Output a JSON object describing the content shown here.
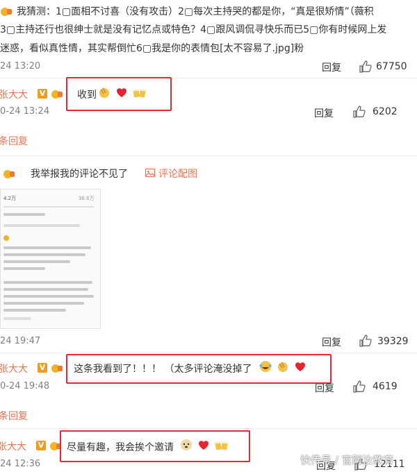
{
  "comments": [
    {
      "text_line1": "我猜测：1▢面相不讨喜（没有攻击）2▢每次主持哭的都是你，“真是很矫情”（薇积",
      "text_line2": "3▢主持还行也很绅士就是没有记忆点或特色？4▢跟风调侃寻快乐而已5▢你有时候网上发",
      "text_line3": "迷惑，看似真性情，其实帮倒忙6▢我是你的表情包[太不容易了.jpg]粉",
      "time": "24 13:20",
      "reply_label": "回复",
      "likes": "67750"
    },
    {
      "author": "张大大",
      "text": "收到",
      "time": "0-24 13:24",
      "reply_label": "回复",
      "likes": "6202",
      "more_replies": "条回复"
    },
    {
      "text": "我举报我的评论不见了",
      "image_link": "评论配图",
      "time": "24 19:47",
      "reply_label": "回复",
      "likes": "39329"
    },
    {
      "author": "张大大",
      "text": "这条我看到了！！！ （太多评论淹没掉了",
      "time": "0-24 19:48",
      "reply_label": "回复",
      "likes": "4619",
      "more_replies": "条回复"
    },
    {
      "author": "张大大",
      "text": "尽量有趣，我会挨个邀请",
      "time": "24 12:36",
      "reply_label": "回复",
      "likes": "12111"
    }
  ],
  "screenshot_thumb": {
    "count": "4.2万",
    "right_count": "36.6万"
  },
  "watermark": "快传号 / 官阿汝教育",
  "colors": {
    "accent": "#eb7350",
    "highlight_box": "#e8282b",
    "vip": "#f29b1d"
  },
  "icons": [
    "fan-badge-icon",
    "verified-v-icon",
    "thumbs-up-icon",
    "image-icon",
    "clap-emoji-icon",
    "heart-emoji-icon",
    "cheers-emoji-icon",
    "laugh-cry-emoji-icon",
    "dog-face-emoji-icon"
  ]
}
